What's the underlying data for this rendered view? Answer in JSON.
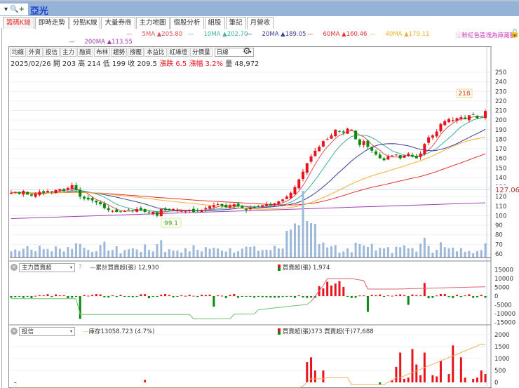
{
  "header": {
    "search_symbol": "▾ 🔍+",
    "stock_name": "亞光"
  },
  "tabs": [
    {
      "label": "籌碼K線",
      "active": true
    },
    {
      "label": "即時走勢"
    },
    {
      "label": "分點K線"
    },
    {
      "label": "大量券商"
    },
    {
      "label": "主力地圖"
    },
    {
      "label": "個股分析"
    },
    {
      "label": "組股"
    },
    {
      "label": "筆記"
    },
    {
      "label": "月營收"
    }
  ],
  "ma_legend": [
    {
      "label": "5MA ▲205.80",
      "color": "#e05050"
    },
    {
      "label": "10MA ▲202.70",
      "color": "#40b0a0"
    },
    {
      "label": "20MA ▲189.05",
      "color": "#3a3a9a"
    },
    {
      "label": "60MA ▲160.46",
      "color": "#e83030"
    },
    {
      "label": "40MA ▲179.11",
      "color": "#f0b030"
    },
    {
      "label": "200MA ▲113.55",
      "color": "#a040b0"
    }
  ],
  "treasury_note": "ⓘ粉紅色區塊為庫藏股",
  "toolbar": {
    "buttons": [
      "均線",
      "外資",
      "投信",
      "主力",
      "融資",
      "布林",
      "趨勢",
      "撐壓",
      "本益比",
      "紅綠燈",
      "分價量"
    ],
    "period": "日線"
  },
  "info": {
    "date": "2025/02/26",
    "open": "開 203",
    "high": "高 214",
    "low": "低 199",
    "close": "收 209.5",
    "change": "漲跌 6.5",
    "pct": "漲幅 3.2%",
    "volume": "量 48,972"
  },
  "price_axis": {
    "ticks": [
      "250",
      "240",
      "230",
      "220",
      "210",
      "200",
      "190",
      "180",
      "170",
      "160",
      "150",
      "140",
      "130",
      "120",
      "110",
      "100",
      "90",
      "80",
      "70",
      "60"
    ],
    "crosshair": "127.06",
    "high_label": "218",
    "low_label": "99.1"
  },
  "panel2": {
    "select": "主力買賣超",
    "help": "?",
    "line_label": "累計買賣超(張) 12,930",
    "bar_label": "買賣超(張) 1,974",
    "ticks": [
      "15000",
      "10000",
      "5000",
      "0",
      "-5000",
      "-10000",
      "-15000"
    ]
  },
  "panel3": {
    "select": "投信",
    "line_label": "庫存13058.723 (4.7%)",
    "bar_label": "買賣超(張)373 買賣超(千)77,688",
    "ticks": [
      "2000",
      "1500",
      "1000",
      "500",
      "0"
    ]
  },
  "colors": {
    "up": "#e8141c",
    "down": "#0a8a0a",
    "volume": "#9db8d8"
  },
  "chart_data": {
    "type": "candlestick",
    "closes": [
      124,
      125,
      123,
      126,
      122,
      121,
      123,
      125,
      124,
      126,
      125,
      127,
      128,
      126,
      129,
      132,
      127,
      120,
      118,
      117,
      116,
      114,
      112,
      108,
      106,
      105,
      104,
      104,
      105,
      106,
      105,
      107,
      106,
      104,
      103,
      104,
      100,
      107,
      106,
      106,
      107,
      106,
      105,
      105,
      106,
      104,
      105,
      106,
      108,
      110,
      111,
      112,
      110,
      109,
      111,
      112,
      110,
      108,
      106,
      108,
      109,
      110,
      111,
      112,
      111,
      113,
      115,
      117,
      120,
      124,
      130,
      138,
      146,
      155,
      162,
      168,
      172,
      178,
      180,
      184,
      190,
      188,
      187,
      191,
      190,
      180,
      174,
      178,
      172,
      168,
      164,
      160,
      158,
      162,
      163,
      164,
      160,
      163,
      165,
      162,
      160,
      165,
      175,
      182,
      184,
      188,
      196,
      199,
      201,
      200,
      202,
      203,
      201,
      205,
      206,
      202,
      203,
      209.5
    ],
    "ylim": [
      55,
      255
    ]
  }
}
